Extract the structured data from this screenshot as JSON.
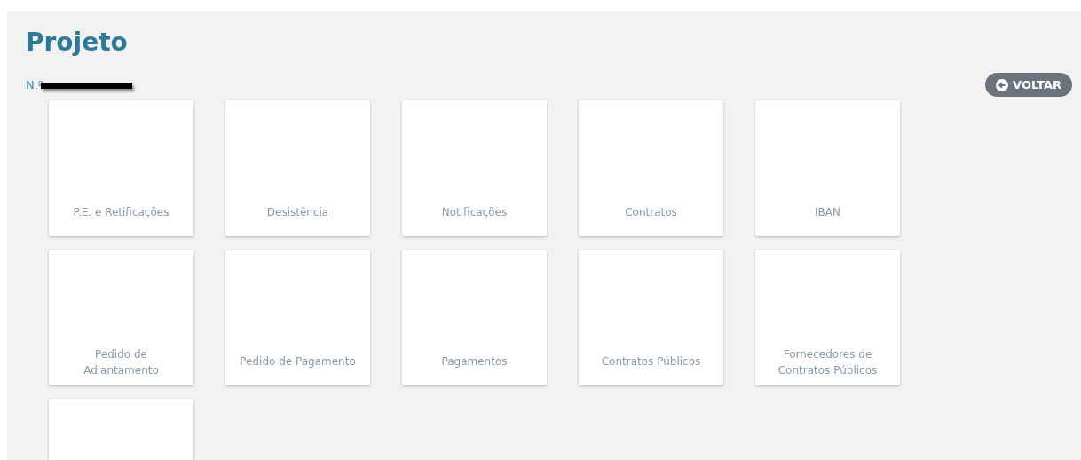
{
  "page": {
    "title": "Projeto",
    "project_number_label": "N.º"
  },
  "back_button": {
    "label": "VOLTAR"
  },
  "tiles": [
    {
      "label": "P.E. e Retificações"
    },
    {
      "label": "Desistência"
    },
    {
      "label": "Notificações"
    },
    {
      "label": "Contratos"
    },
    {
      "label": "IBAN"
    },
    {
      "label": "Pedido de Adiantamento"
    },
    {
      "label": "Pedido de Pagamento"
    },
    {
      "label": "Pagamentos"
    },
    {
      "label": "Contratos Públicos"
    },
    {
      "label": "Fornecedores de Contratos Públicos"
    },
    {
      "kind": "blank"
    }
  ]
}
